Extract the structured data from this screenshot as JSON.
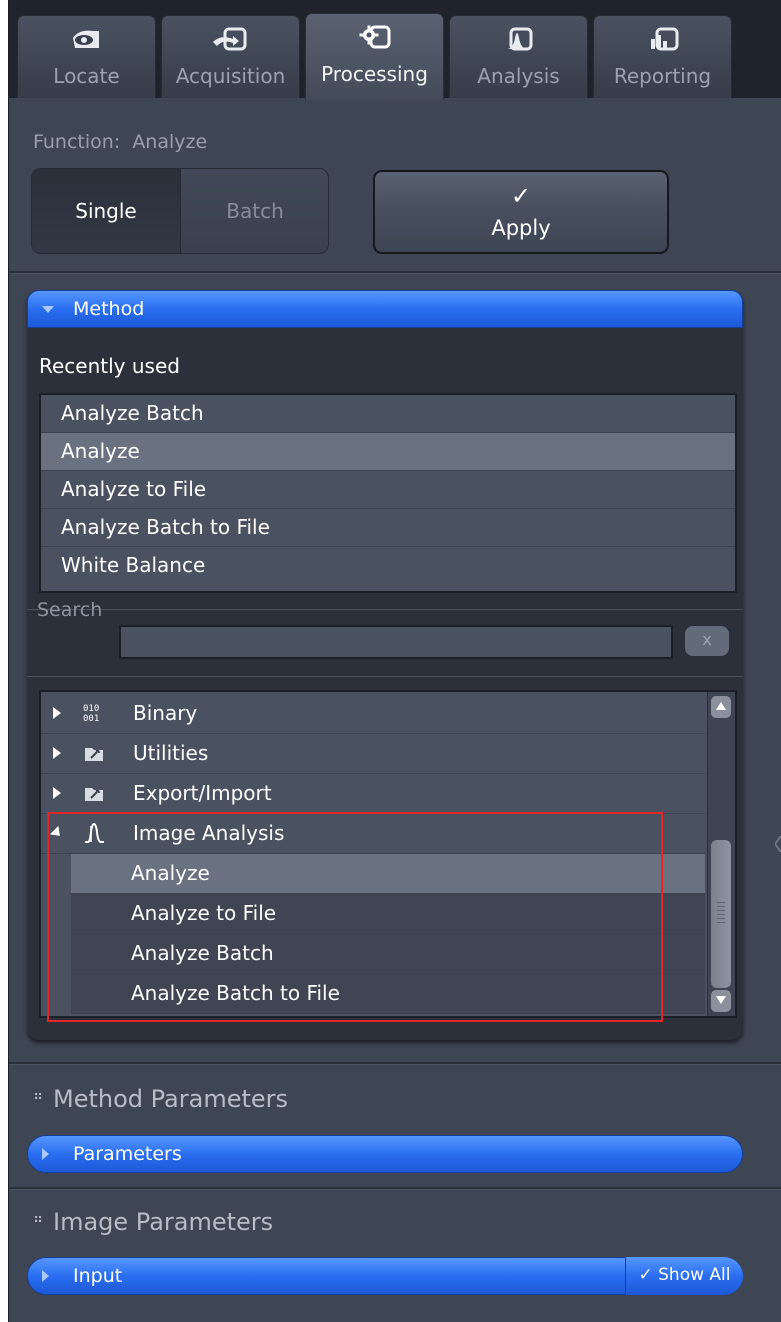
{
  "tabs": [
    {
      "label": "Locate",
      "icon": "eye-icon"
    },
    {
      "label": "Acquisition",
      "icon": "acquisition-icon"
    },
    {
      "label": "Processing",
      "icon": "gear-monitor-icon",
      "active": true
    },
    {
      "label": "Analysis",
      "icon": "peak-icon"
    },
    {
      "label": "Reporting",
      "icon": "bar-chart-icon"
    }
  ],
  "function": {
    "label": "Function:",
    "value": "Analyze"
  },
  "mode": {
    "single": "Single",
    "batch": "Batch",
    "selected": "Single"
  },
  "apply": {
    "check": "✓",
    "label": "Apply"
  },
  "method": {
    "header": "Method",
    "recently_used_label": "Recently used",
    "recent": [
      "Analyze Batch",
      "Analyze",
      "Analyze to File",
      "Analyze Batch to File",
      "White Balance"
    ],
    "recent_selected": "Analyze",
    "search_label": "Search",
    "search_value": "",
    "clear_label": "x",
    "tree": [
      {
        "label": "Binary",
        "icon": "binary-icon",
        "expanded": false
      },
      {
        "label": "Utilities",
        "icon": "folder-wrench-icon",
        "expanded": false
      },
      {
        "label": "Export/Import",
        "icon": "folder-wrench-icon",
        "expanded": false
      },
      {
        "label": "Image Analysis",
        "icon": "histogram-peak-icon",
        "expanded": true,
        "children": [
          "Analyze",
          "Analyze to File",
          "Analyze Batch",
          "Analyze Batch to File"
        ]
      }
    ],
    "tree_selected": "Analyze"
  },
  "method_parameters": {
    "title": "Method Parameters",
    "bar": "Parameters"
  },
  "image_parameters": {
    "title": "Image Parameters",
    "bar": "Input",
    "show_all": "Show All",
    "show_all_check": "✓"
  },
  "colors": {
    "accent_blue": "#2a6ef0",
    "panel_bg": "#3e4553",
    "highlight_red": "#e02626"
  }
}
